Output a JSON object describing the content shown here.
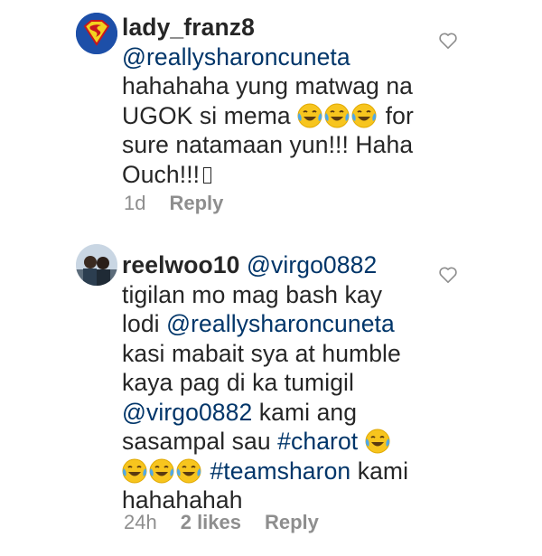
{
  "comments": [
    {
      "username": "lady_franz8",
      "mention": "@reallysharoncuneta",
      "line1": "hahahaha yung matwag na",
      "line2_text": "UGOK si mema",
      "line2_tail": "for",
      "line3": "sure natamaan yun!!! Haha",
      "line4": "Ouch!!!",
      "time": "1d",
      "reply": "Reply",
      "avatar_icon": "superman-logo-icon",
      "emoji_icon": "face-with-tears-of-joy-icon"
    },
    {
      "username": "reelwoo10",
      "mention1": "@virgo0882",
      "line1": "tigilan mo mag bash kay",
      "line2_prefix": "lodi",
      "mention2": "@reallysharoncuneta",
      "line3": "kasi mabait sya at humble",
      "line4": "kaya pag di ka tumigil",
      "mention3": "@virgo0882",
      "line5_tail": "kami ang",
      "line6_prefix": "sasampal sau",
      "hashtag1": "#charot",
      "hashtag2": "#teamsharon",
      "line7_tail": "kami",
      "line8": "hahahahah",
      "time": "24h",
      "likes": "2 likes",
      "reply": "Reply",
      "avatar_icon": "couple-photo-icon",
      "emoji_icon": "face-with-tears-of-joy-icon"
    }
  ],
  "colors": {
    "text": "#262626",
    "link": "#003569",
    "meta": "#8e8e8e"
  }
}
